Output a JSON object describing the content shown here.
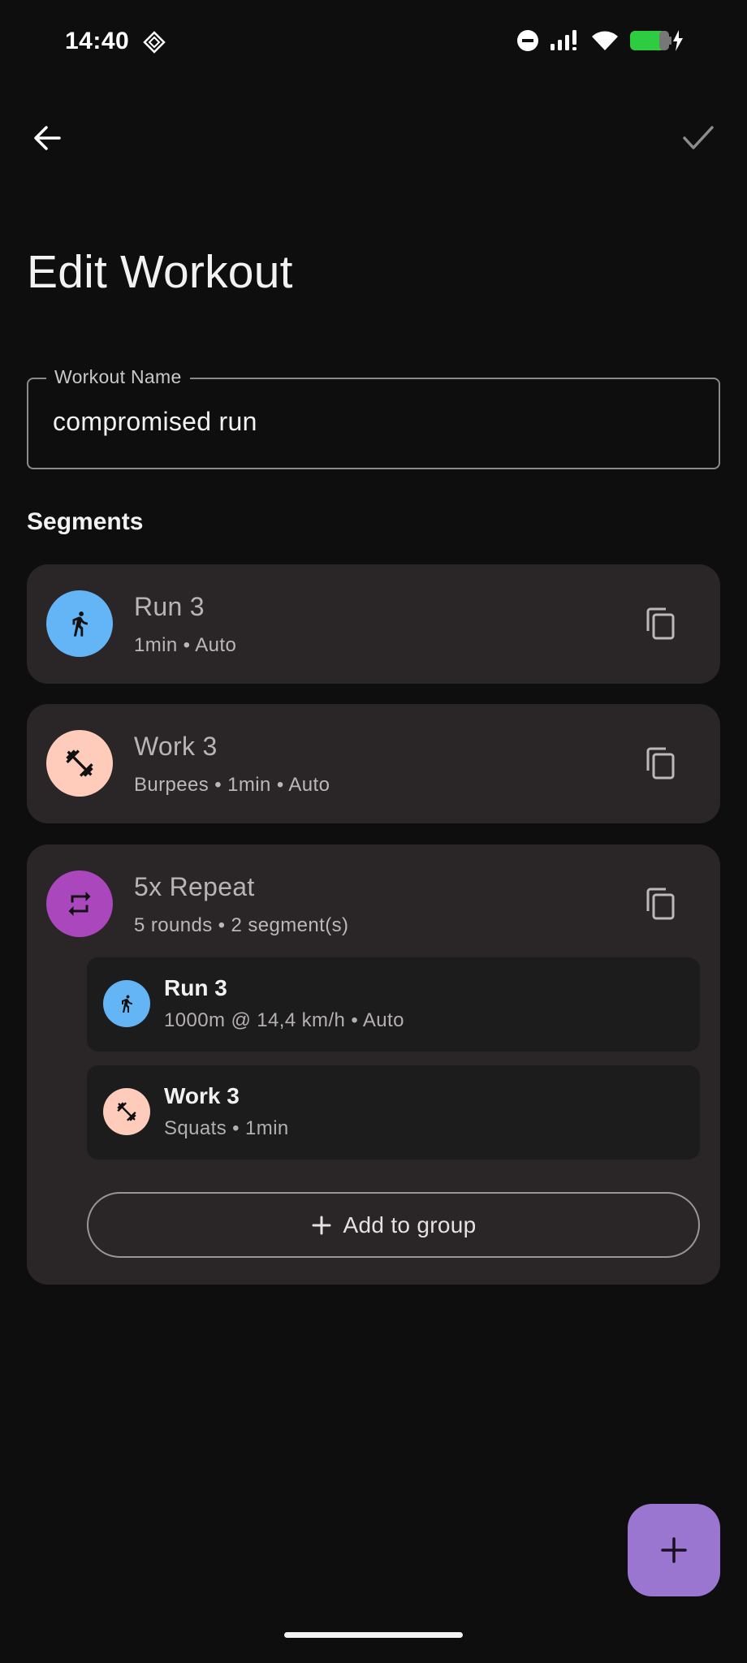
{
  "status_bar": {
    "time": "14:40",
    "icons": [
      "diamond-notification-icon",
      "do-not-disturb-icon",
      "signal-icon",
      "wifi-icon",
      "battery-charging-icon"
    ]
  },
  "app_bar": {
    "back_icon": "arrow-back-icon",
    "confirm_icon": "check-icon"
  },
  "page": {
    "title": "Edit Workout"
  },
  "workout_name": {
    "label": "Workout Name",
    "value": "compromised run"
  },
  "segments": {
    "label": "Segments",
    "items": [
      {
        "title": "Run 3",
        "subtitle": "1min • Auto",
        "icon": "running-icon",
        "icon_color": "#64b5f6"
      },
      {
        "title": "Work 3",
        "subtitle": "Burpees • 1min • Auto",
        "icon": "dumbbell-icon",
        "icon_color": "#ffccbc"
      },
      {
        "title": "5x Repeat",
        "subtitle": "5 rounds • 2 segment(s)",
        "icon": "repeat-icon",
        "icon_color": "#ab47bc",
        "children": [
          {
            "title": "Run 3",
            "subtitle": "1000m @ 14,4 km/h • Auto",
            "icon": "running-icon",
            "icon_color": "#64b5f6"
          },
          {
            "title": "Work 3",
            "subtitle": "Squats • 1min",
            "icon": "dumbbell-icon",
            "icon_color": "#ffccbc"
          }
        ],
        "add_label": "Add to group"
      }
    ]
  },
  "fab": {
    "icon": "plus-icon",
    "color": "#9a76d0"
  }
}
